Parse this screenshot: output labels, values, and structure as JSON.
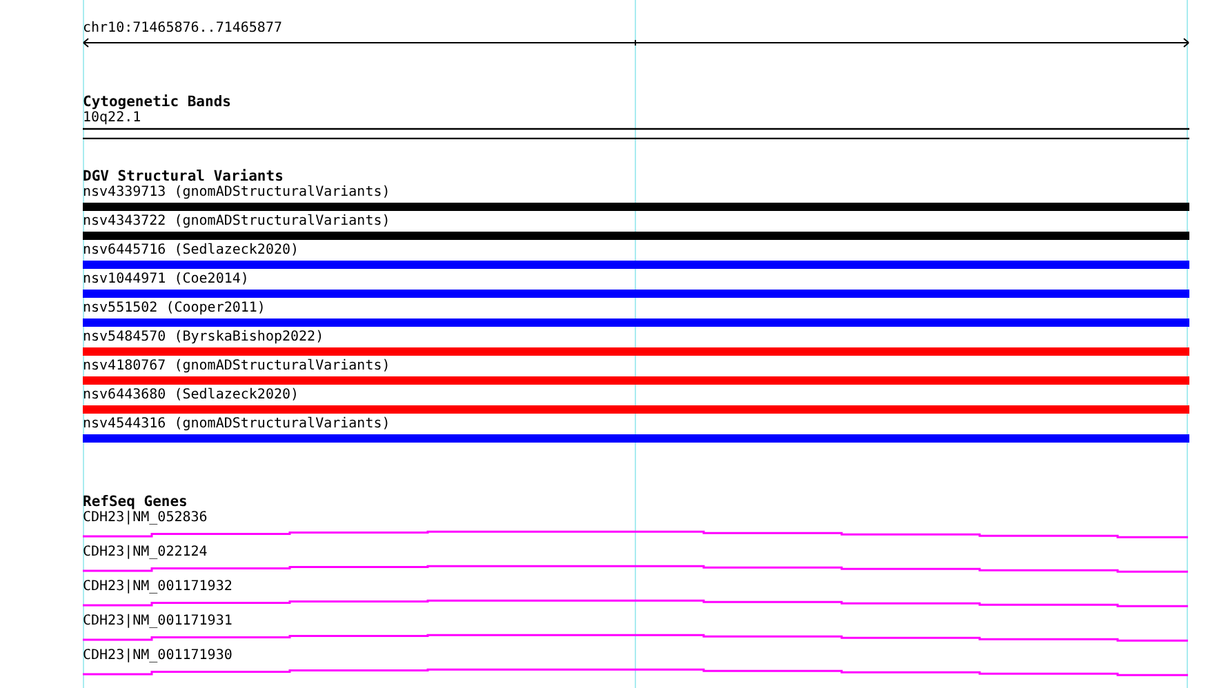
{
  "location": "chr10:71465876..71465877",
  "tracks": [
    {
      "kind": "cytoband",
      "title": "Cytogenetic Bands",
      "features": [
        {
          "label": "10q22.1"
        }
      ]
    },
    {
      "kind": "variants",
      "title": "DGV Structural Variants",
      "features": [
        {
          "label": "nsv4339713 (gnomADStructuralVariants)",
          "color": "#000000"
        },
        {
          "label": "nsv4343722 (gnomADStructuralVariants)",
          "color": "#000000"
        },
        {
          "label": "nsv6445716 (Sedlazeck2020)",
          "color": "#0000ff"
        },
        {
          "label": "nsv1044971 (Coe2014)",
          "color": "#0000ff"
        },
        {
          "label": "nsv551502 (Cooper2011)",
          "color": "#0000ff"
        },
        {
          "label": "nsv5484570 (ByrskaBishop2022)",
          "color": "#ff0000"
        },
        {
          "label": "nsv4180767 (gnomADStructuralVariants)",
          "color": "#ff0000"
        },
        {
          "label": "nsv6443680 (Sedlazeck2020)",
          "color": "#ff0000"
        },
        {
          "label": "nsv4544316 (gnomADStructuralVariants)",
          "color": "#0000ff"
        }
      ]
    },
    {
      "kind": "genes",
      "title": "RefSeq Genes",
      "features": [
        {
          "label": "CDH23|NM_052836"
        },
        {
          "label": "CDH23|NM_022124"
        },
        {
          "label": "CDH23|NM_001171932"
        },
        {
          "label": "CDH23|NM_001171931"
        },
        {
          "label": "CDH23|NM_001171930"
        }
      ]
    }
  ]
}
